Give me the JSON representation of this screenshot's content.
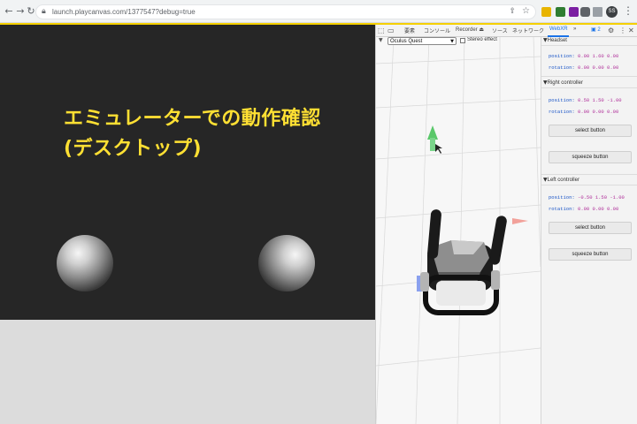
{
  "browser": {
    "url": "launch.playcanvas.com/1377547?debug=true",
    "avatar_initials": "SS",
    "icons": [
      "back-icon",
      "forward-icon",
      "reload-icon",
      "lock-icon",
      "share-icon",
      "star-icon",
      "extension-icon",
      "puzzle-icon",
      "profile-icon",
      "menu-icon"
    ]
  },
  "game": {
    "title_line1": "エミュレーターでの動作確認",
    "title_line2": "(デスクトップ)",
    "title_color": "#ffe033",
    "background_color": "#262626"
  },
  "devtools": {
    "tabs": [
      "要素",
      "コンソール",
      "Recorder ⏏",
      "ソース",
      "ネットワーク",
      "WebXR"
    ],
    "active_tab": "WebXR",
    "more_tabs": "»",
    "issue_count": "2",
    "emulator": {
      "device": "Oculus Quest",
      "stereo_label": "Stereo effect"
    },
    "panel": {
      "headset": {
        "title": "Headset",
        "position_label": "position:",
        "position_value": "0.00 1.60 0.00",
        "rotation_label": "rotation:",
        "rotation_value": "0.00 0.00 0.00"
      },
      "right_controller": {
        "title": "Right controller",
        "position_label": "position:",
        "position_value": "0.50 1.50 -1.00",
        "rotation_label": "rotation:",
        "rotation_value": "0.00 0.00 0.00",
        "select_label": "select button",
        "squeeze_label": "squeeze button"
      },
      "left_controller": {
        "title": "Left controller",
        "position_label": "position:",
        "position_value": "-0.50 1.50 -1.00",
        "rotation_label": "rotation:",
        "rotation_value": "0.00 0.00 0.00",
        "select_label": "select button",
        "squeeze_label": "squeeze button"
      }
    }
  }
}
